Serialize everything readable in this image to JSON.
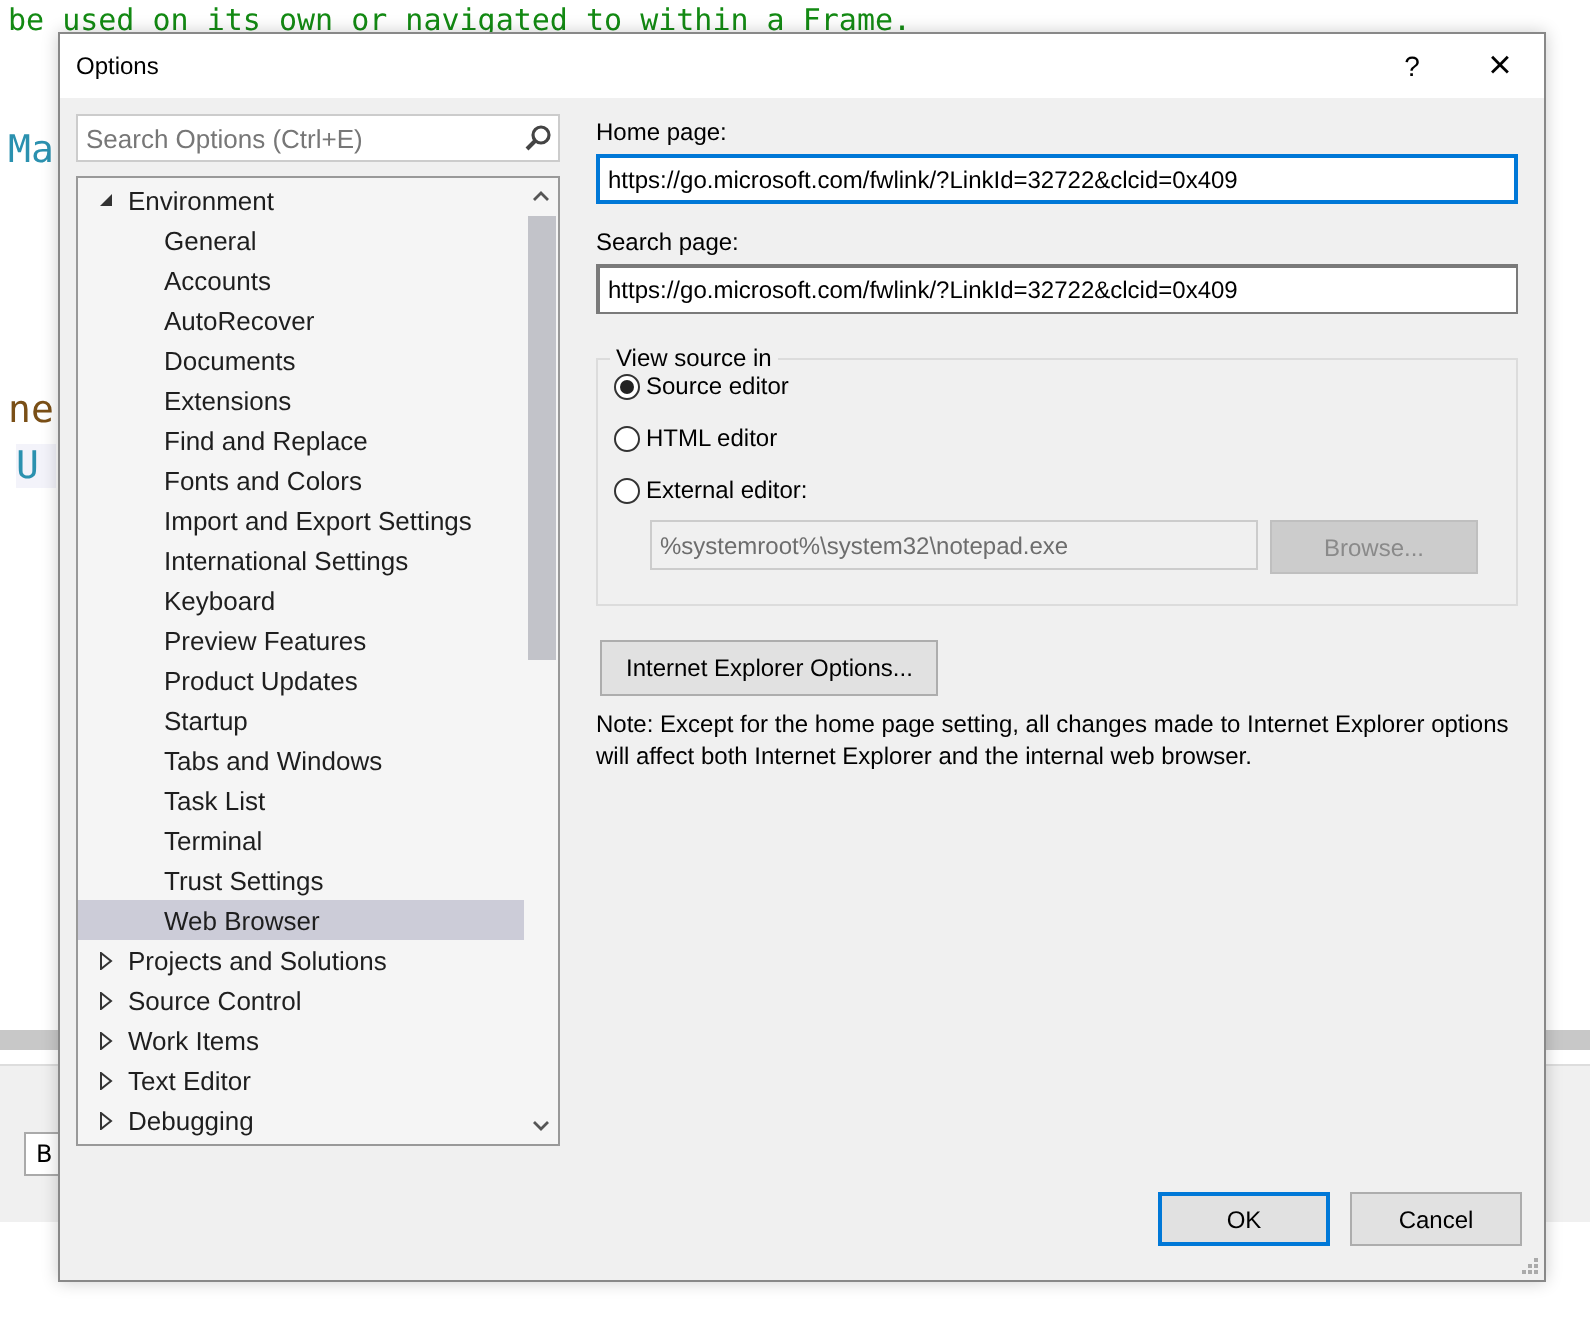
{
  "background_editor": {
    "code_lines": [
      {
        "kind": "comment",
        "text": "be used on its own or navigated to within a Frame."
      },
      {
        "kind": "link",
        "text": "Ma"
      },
      {
        "kind": "heading",
        "text": "ne"
      },
      {
        "kind": "keyword",
        "text": "U"
      }
    ],
    "toolbar_field": "B"
  },
  "window": {
    "title": "Options",
    "help": "?",
    "close": "×"
  },
  "search": {
    "placeholder": "Search Options (Ctrl+E)"
  },
  "tree": [
    {
      "label": "Environment",
      "expanded": true,
      "selected": false,
      "children": [
        {
          "label": "General",
          "selected": false
        },
        {
          "label": "Accounts",
          "selected": false
        },
        {
          "label": "AutoRecover",
          "selected": false
        },
        {
          "label": "Documents",
          "selected": false
        },
        {
          "label": "Extensions",
          "selected": false
        },
        {
          "label": "Find and Replace",
          "selected": false
        },
        {
          "label": "Fonts and Colors",
          "selected": false
        },
        {
          "label": "Import and Export Settings",
          "selected": false
        },
        {
          "label": "International Settings",
          "selected": false
        },
        {
          "label": "Keyboard",
          "selected": false
        },
        {
          "label": "Preview Features",
          "selected": false
        },
        {
          "label": "Product Updates",
          "selected": false
        },
        {
          "label": "Startup",
          "selected": false
        },
        {
          "label": "Tabs and Windows",
          "selected": false
        },
        {
          "label": "Task List",
          "selected": false
        },
        {
          "label": "Terminal",
          "selected": false
        },
        {
          "label": "Trust Settings",
          "selected": false
        },
        {
          "label": "Web Browser",
          "selected": true
        }
      ]
    },
    {
      "label": "Projects and Solutions",
      "expanded": false,
      "selected": false
    },
    {
      "label": "Source Control",
      "expanded": false,
      "selected": false
    },
    {
      "label": "Work Items",
      "expanded": false,
      "selected": false
    },
    {
      "label": "Text Editor",
      "expanded": false,
      "selected": false
    },
    {
      "label": "Debugging",
      "expanded": false,
      "selected": false
    }
  ],
  "home_page": {
    "label": "Home page:",
    "value": "https://go.microsoft.com/fwlink/?LinkId=32722&clcid=0x409",
    "focused": true
  },
  "search_page": {
    "label": "Search page:",
    "value": "https://go.microsoft.com/fwlink/?LinkId=32722&clcid=0x409",
    "focused": false
  },
  "view_source": {
    "title": "View source in",
    "options": [
      {
        "label": "Source editor",
        "selected": true
      },
      {
        "label": "HTML editor",
        "selected": false
      },
      {
        "label": "External editor:",
        "selected": false
      }
    ],
    "editor_path": {
      "value": "%systemroot%\\system32\\notepad.exe",
      "disabled": true
    },
    "browse_button": {
      "label": "Browse...",
      "disabled": true
    }
  },
  "ie_options_button": "Internet Explorer Options...",
  "note": "Note: Except for the home page setting, all changes made to Internet Explorer options will affect both Internet Explorer and the internal web browser.",
  "buttons": [
    {
      "label": "OK",
      "default": true
    },
    {
      "label": "Cancel",
      "default": false
    }
  ]
}
